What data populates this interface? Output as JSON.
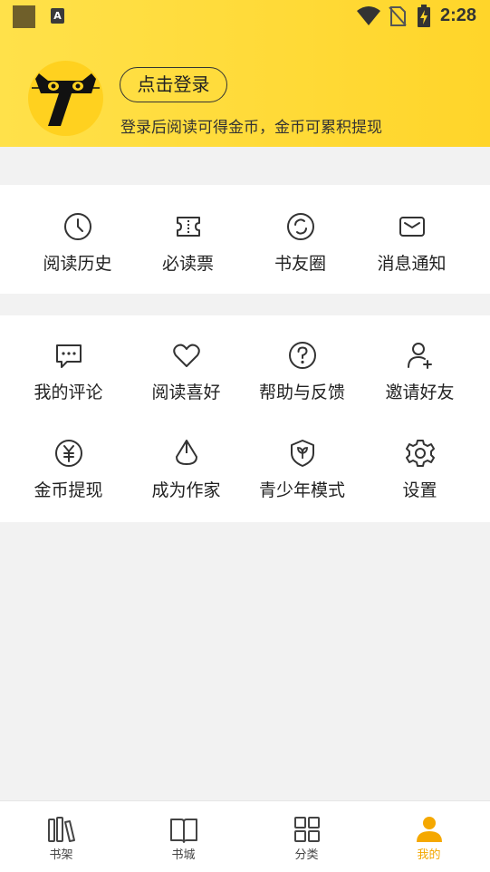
{
  "status_bar": {
    "time": "2:28",
    "notif_letter": "A"
  },
  "profile": {
    "login_label": "点击登录",
    "subtitle": "登录后阅读可得金币，金币可累积提现"
  },
  "menu_primary": [
    {
      "label": "阅读历史",
      "icon": "clock-icon"
    },
    {
      "label": "必读票",
      "icon": "ticket-icon"
    },
    {
      "label": "书友圈",
      "icon": "circle-icon"
    },
    {
      "label": "消息通知",
      "icon": "mail-icon"
    }
  ],
  "menu_secondary": [
    {
      "label": "我的评论",
      "icon": "comment-icon"
    },
    {
      "label": "阅读喜好",
      "icon": "heart-icon"
    },
    {
      "label": "帮助与反馈",
      "icon": "help-icon"
    },
    {
      "label": "邀请好友",
      "icon": "add-user-icon"
    },
    {
      "label": "金币提现",
      "icon": "coin-icon"
    },
    {
      "label": "成为作家",
      "icon": "pen-nib-icon"
    },
    {
      "label": "青少年模式",
      "icon": "shield-icon"
    },
    {
      "label": "设置",
      "icon": "gear-icon"
    }
  ],
  "tabbar": [
    {
      "label": "书架",
      "icon": "bookshelf-icon",
      "active": false
    },
    {
      "label": "书城",
      "icon": "book-icon",
      "active": false
    },
    {
      "label": "分类",
      "icon": "grid-icon",
      "active": false
    },
    {
      "label": "我的",
      "icon": "user-icon",
      "active": true
    }
  ],
  "colors": {
    "accent": "#ffd52a",
    "active_tab": "#f3a700"
  }
}
